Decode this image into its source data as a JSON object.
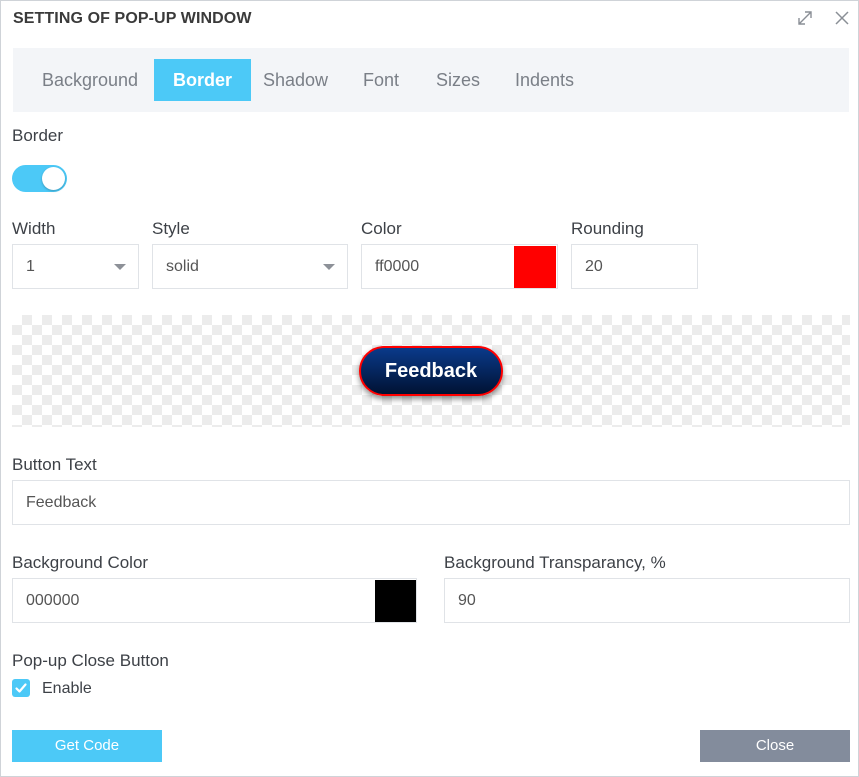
{
  "window": {
    "title": "SETTING OF POP-UP WINDOW",
    "maximize_icon": "expand-icon",
    "close_icon": "close-icon"
  },
  "tabs": [
    {
      "label": "Background",
      "active": false
    },
    {
      "label": "Border",
      "active": true
    },
    {
      "label": "Shadow",
      "active": false
    },
    {
      "label": "Font",
      "active": false
    },
    {
      "label": "Sizes",
      "active": false
    },
    {
      "label": "Indents",
      "active": false
    }
  ],
  "border": {
    "section_label": "Border",
    "enabled": true,
    "width": {
      "label": "Width",
      "value": "1"
    },
    "style": {
      "label": "Style",
      "value": "solid"
    },
    "color": {
      "label": "Color",
      "value": "ff0000",
      "swatch": "#ff0000"
    },
    "rounding": {
      "label": "Rounding",
      "value": "20"
    }
  },
  "preview": {
    "button_text": "Feedback"
  },
  "button_text": {
    "label": "Button Text",
    "value": "Feedback"
  },
  "background_color": {
    "label": "Background Color",
    "value": "000000",
    "swatch": "#000000"
  },
  "background_transparency": {
    "label": "Background Transparancy, %",
    "value": "90"
  },
  "close_button": {
    "label": "Pop-up Close Button",
    "checkbox_label": "Enable",
    "checked": true
  },
  "actions": {
    "get_code": "Get Code",
    "close": "Close"
  },
  "colors": {
    "accent": "#4cc9f7",
    "secondary_button": "#838c9c"
  }
}
